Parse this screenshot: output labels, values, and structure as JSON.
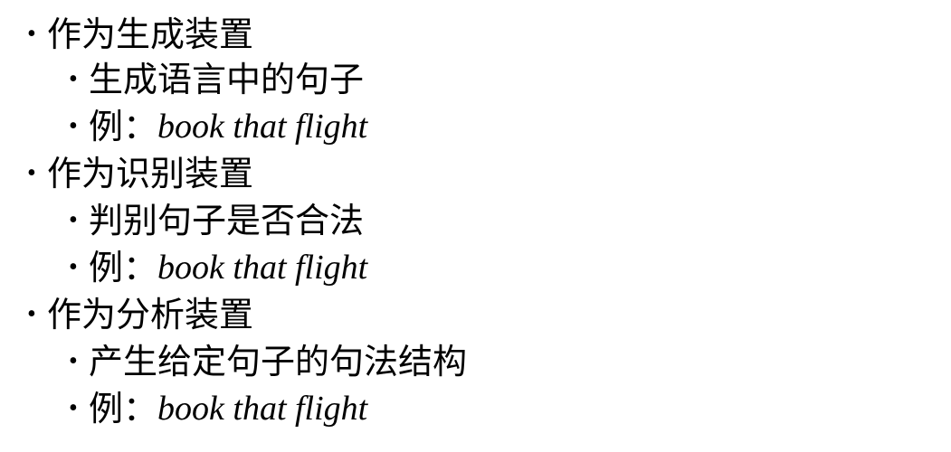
{
  "bullet_glyph": "•",
  "sections": [
    {
      "heading": "作为生成装置",
      "sub": "生成语言中的句子",
      "example_label": "例：",
      "example_text": "book that flight"
    },
    {
      "heading": "作为识别装置",
      "sub": "判别句子是否合法",
      "example_label": "例：",
      "example_text": "book that flight"
    },
    {
      "heading": "作为分析装置",
      "sub": "产生给定句子的句法结构",
      "example_label": "例：",
      "example_text": "book that flight"
    }
  ]
}
